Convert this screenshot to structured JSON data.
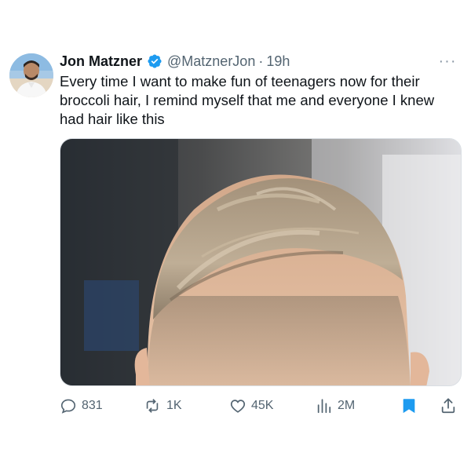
{
  "tweet": {
    "author_name": "Jon Matzner",
    "handle": "@MatznerJon",
    "separator": "·",
    "time": "19h",
    "text_lines": [
      "Every time I want to make fun of teenagers now for their",
      "broccoli hair, I remind myself that me and everyone I knew",
      "had hair like this"
    ],
    "more_label": "···",
    "verified_icon": "verified-badge-icon",
    "media": {
      "description_icon": "haircut-photo"
    }
  },
  "actions": {
    "replies": "831",
    "reposts": "1K",
    "likes": "45K",
    "views": "2M"
  },
  "colors": {
    "text": "#0f1419",
    "secondary": "#536471",
    "accent_blue": "#1d9bf0"
  }
}
